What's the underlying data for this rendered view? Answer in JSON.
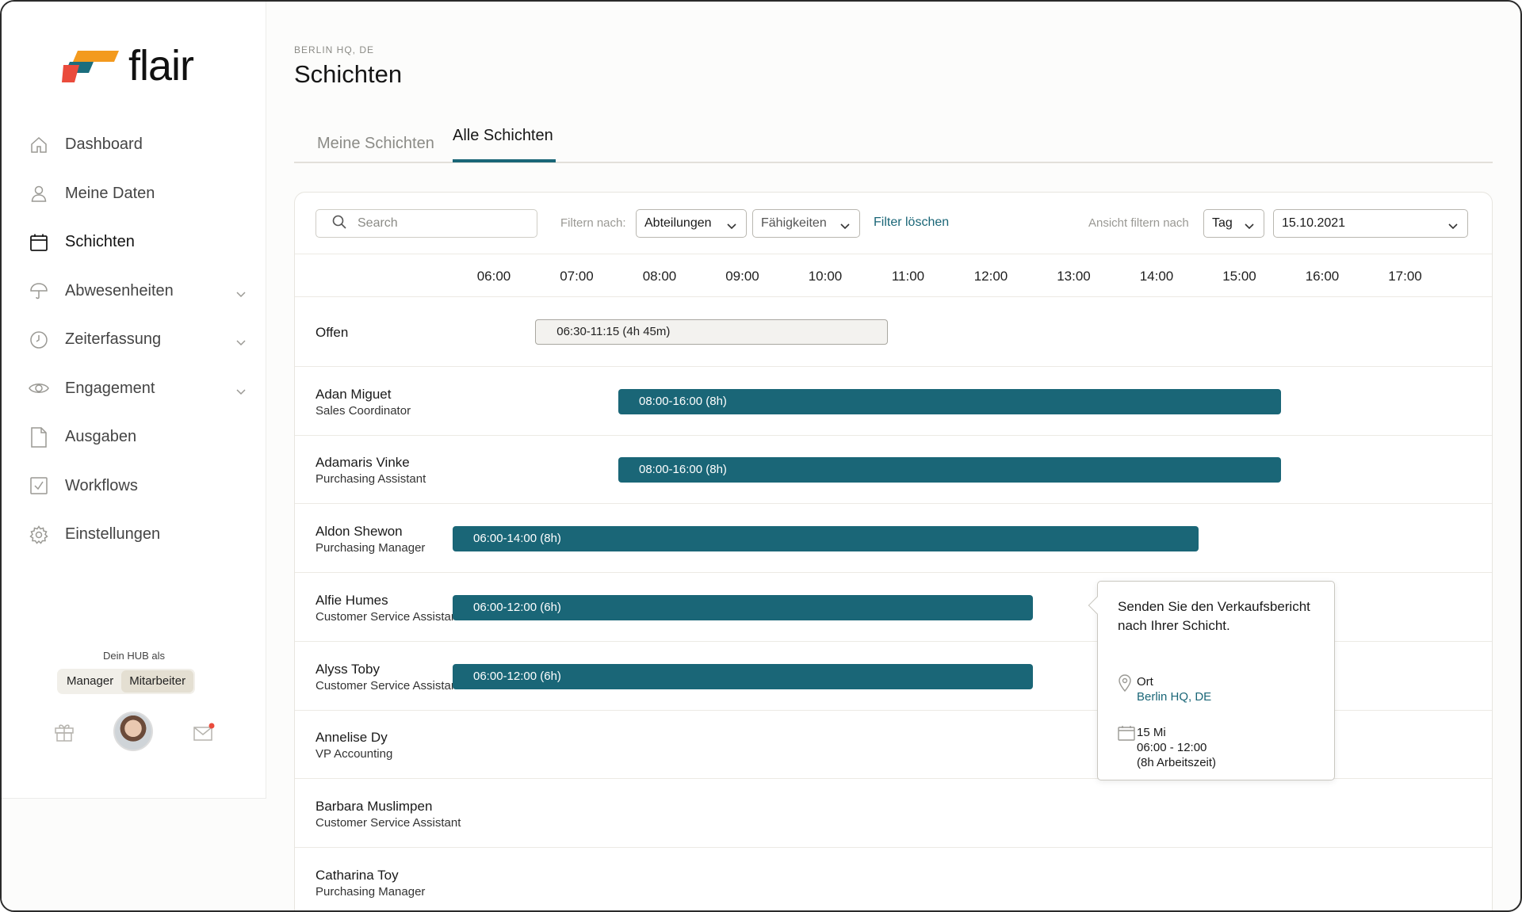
{
  "app": {
    "name": "flair"
  },
  "sidebar": {
    "items": [
      {
        "label": "Dashboard",
        "icon": "home-icon",
        "expandable": false
      },
      {
        "label": "Meine Daten",
        "icon": "user-icon",
        "expandable": false
      },
      {
        "label": "Schichten",
        "icon": "calendar-icon",
        "expandable": false,
        "active": true
      },
      {
        "label": "Abwesenheiten",
        "icon": "umbrella-icon",
        "expandable": true
      },
      {
        "label": "Zeiterfassung",
        "icon": "clock-icon",
        "expandable": true
      },
      {
        "label": "Engagement",
        "icon": "eye-icon",
        "expandable": true
      },
      {
        "label": "Ausgaben",
        "icon": "document-icon",
        "expandable": false
      },
      {
        "label": "Workflows",
        "icon": "checkbox-icon",
        "expandable": false
      },
      {
        "label": "Einstellungen",
        "icon": "gear-icon",
        "expandable": false
      }
    ],
    "hub_label": "Dein HUB als",
    "hub_options": [
      "Manager",
      "Mitarbeiter"
    ],
    "hub_selected": "Mitarbeiter"
  },
  "header": {
    "breadcrumb": "BERLIN HQ, DE",
    "title": "Schichten",
    "tabs": [
      {
        "label": "Meine Schichten",
        "active": false
      },
      {
        "label": "Alle Schichten",
        "active": true
      }
    ]
  },
  "toolbar": {
    "search_placeholder": "Search",
    "filter_label": "Filtern nach:",
    "filter_departments": "Abteilungen",
    "filter_skills": "Fähigkeiten",
    "clear_filter": "Filter löschen",
    "view_label": "Ansicht filtern nach",
    "view_mode": "Tag",
    "date": "15.10.2021"
  },
  "timeline": {
    "hours": [
      "06:00",
      "07:00",
      "08:00",
      "09:00",
      "10:00",
      "11:00",
      "12:00",
      "13:00",
      "14:00",
      "15:00",
      "16:00",
      "17:00"
    ],
    "rows": [
      {
        "name": "Offen",
        "role": "",
        "shift": {
          "label": "06:30-11:15 (4h 45m)",
          "start": 6.5,
          "end": 11.25,
          "open": true
        }
      },
      {
        "name": "Adan Miguet",
        "role": "Sales Coordinator",
        "shift": {
          "label": "08:00-16:00 (8h)",
          "start": 8,
          "end": 16
        }
      },
      {
        "name": "Adamaris Vinke",
        "role": "Purchasing Assistant",
        "shift": {
          "label": "08:00-16:00 (8h)",
          "start": 8,
          "end": 16
        }
      },
      {
        "name": "Aldon Shewon",
        "role": "Purchasing Manager",
        "shift": {
          "label": "06:00-14:00 (8h)",
          "start": 6,
          "end": 15
        }
      },
      {
        "name": "Alfie Humes",
        "role": "Customer Service Assistant",
        "shift": {
          "label": "06:00-12:00 (6h)",
          "start": 6,
          "end": 13
        }
      },
      {
        "name": "Alyss Toby",
        "role": "Customer Service Assistant",
        "shift": {
          "label": "06:00-12:00 (6h)",
          "start": 6,
          "end": 13
        }
      },
      {
        "name": "Annelise Dy",
        "role": "VP Accounting",
        "shift": null
      },
      {
        "name": "Barbara Muslimpen",
        "role": "Customer Service Assistant",
        "shift": null
      },
      {
        "name": "Catharina Toy",
        "role": "Purchasing Manager",
        "shift": null
      }
    ]
  },
  "tooltip": {
    "message": "Senden Sie den Verkaufsbericht nach Ihrer Schicht.",
    "location_label": "Ort",
    "location_value": "Berlin HQ, DE",
    "date_line": "15 Mi",
    "time_line": "06:00 - 12:00",
    "duration_line": "(8h Arbeitszeit)"
  },
  "colors": {
    "accent": "#1a6677",
    "logo_orange": "#f39a1e",
    "logo_red": "#ea4b3c",
    "logo_teal": "#1b6e7e"
  }
}
